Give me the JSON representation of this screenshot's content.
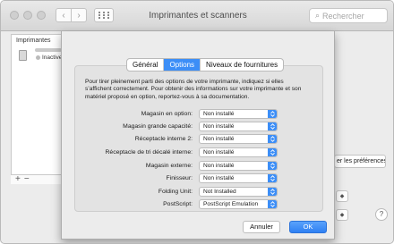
{
  "window": {
    "title": "Imprimantes et scanners",
    "search_placeholder": "Rechercher"
  },
  "background": {
    "printers_label": "Imprimantes",
    "printer_status": "Inactive",
    "share_button": "er les préférences Partage...",
    "add_symbol": "+",
    "remove_symbol": "−",
    "help_symbol": "?"
  },
  "sheet": {
    "tabs": [
      {
        "label": "Général",
        "active": false
      },
      {
        "label": "Options",
        "active": true
      },
      {
        "label": "Niveaux de fournitures",
        "active": false
      }
    ],
    "intro": "Pour tirer pleinement parti des options de votre imprimante, indiquez si elles s’affichent correctement. Pour obtenir des informations sur votre imprimante et son matériel proposé en option, reportez-vous à sa documentation.",
    "options": [
      {
        "label": "Magasin en option:",
        "value": "Non installé"
      },
      {
        "label": "Magasin grande capacité:",
        "value": "Non installé"
      },
      {
        "label": "Réceptacle interne 2:",
        "value": "Non installé"
      },
      {
        "label": "Réceptacle de tri décalé interne:",
        "value": "Non installé"
      },
      {
        "label": "Magasin externe:",
        "value": "Non installé"
      },
      {
        "label": "Finisseur:",
        "value": "Non installé"
      },
      {
        "label": "Folding Unit:",
        "value": "Not Installed"
      },
      {
        "label": "PostScript:",
        "value": "PostScript Emulation"
      }
    ],
    "cancel_label": "Annuler",
    "ok_label": "OK"
  },
  "colors": {
    "accent": "#3c8ef7",
    "window_bg": "#ececec"
  },
  "icons": [
    "close-icon",
    "minimize-icon",
    "zoom-icon",
    "back-icon",
    "forward-icon",
    "grid-icon",
    "search-icon",
    "printer-icon",
    "stepper-icon"
  ]
}
